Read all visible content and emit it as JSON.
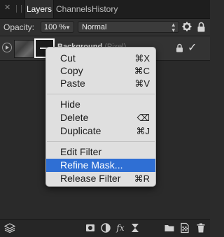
{
  "tabs": [
    {
      "label": "Layers",
      "active": true
    },
    {
      "label": "Channels",
      "active": false
    },
    {
      "label": "History",
      "active": false
    }
  ],
  "toolbar": {
    "opacity_label": "Opacity:",
    "opacity_value": "100 %",
    "blend_mode": "Normal"
  },
  "layer": {
    "name": "Background",
    "kind": "(Pixel)"
  },
  "context_menu": {
    "items": [
      {
        "label": "Cut",
        "shortcut": "⌘X"
      },
      {
        "label": "Copy",
        "shortcut": "⌘C"
      },
      {
        "label": "Paste",
        "shortcut": "⌘V"
      },
      {
        "label": "Hide",
        "shortcut": ""
      },
      {
        "label": "Delete",
        "shortcut": "⌫"
      },
      {
        "label": "Duplicate",
        "shortcut": "⌘J"
      },
      {
        "label": "Edit Filter",
        "shortcut": ""
      },
      {
        "label": "Refine Mask...",
        "shortcut": "",
        "highlighted": true
      },
      {
        "label": "Release Filter",
        "shortcut": "⌘R"
      }
    ]
  },
  "bottom_toolbar": {
    "fx_label": "fx"
  },
  "colors": {
    "panel_bg": "#2a2a2a",
    "menu_bg": "#dfdfdf",
    "highlight": "#2f6fd4"
  }
}
